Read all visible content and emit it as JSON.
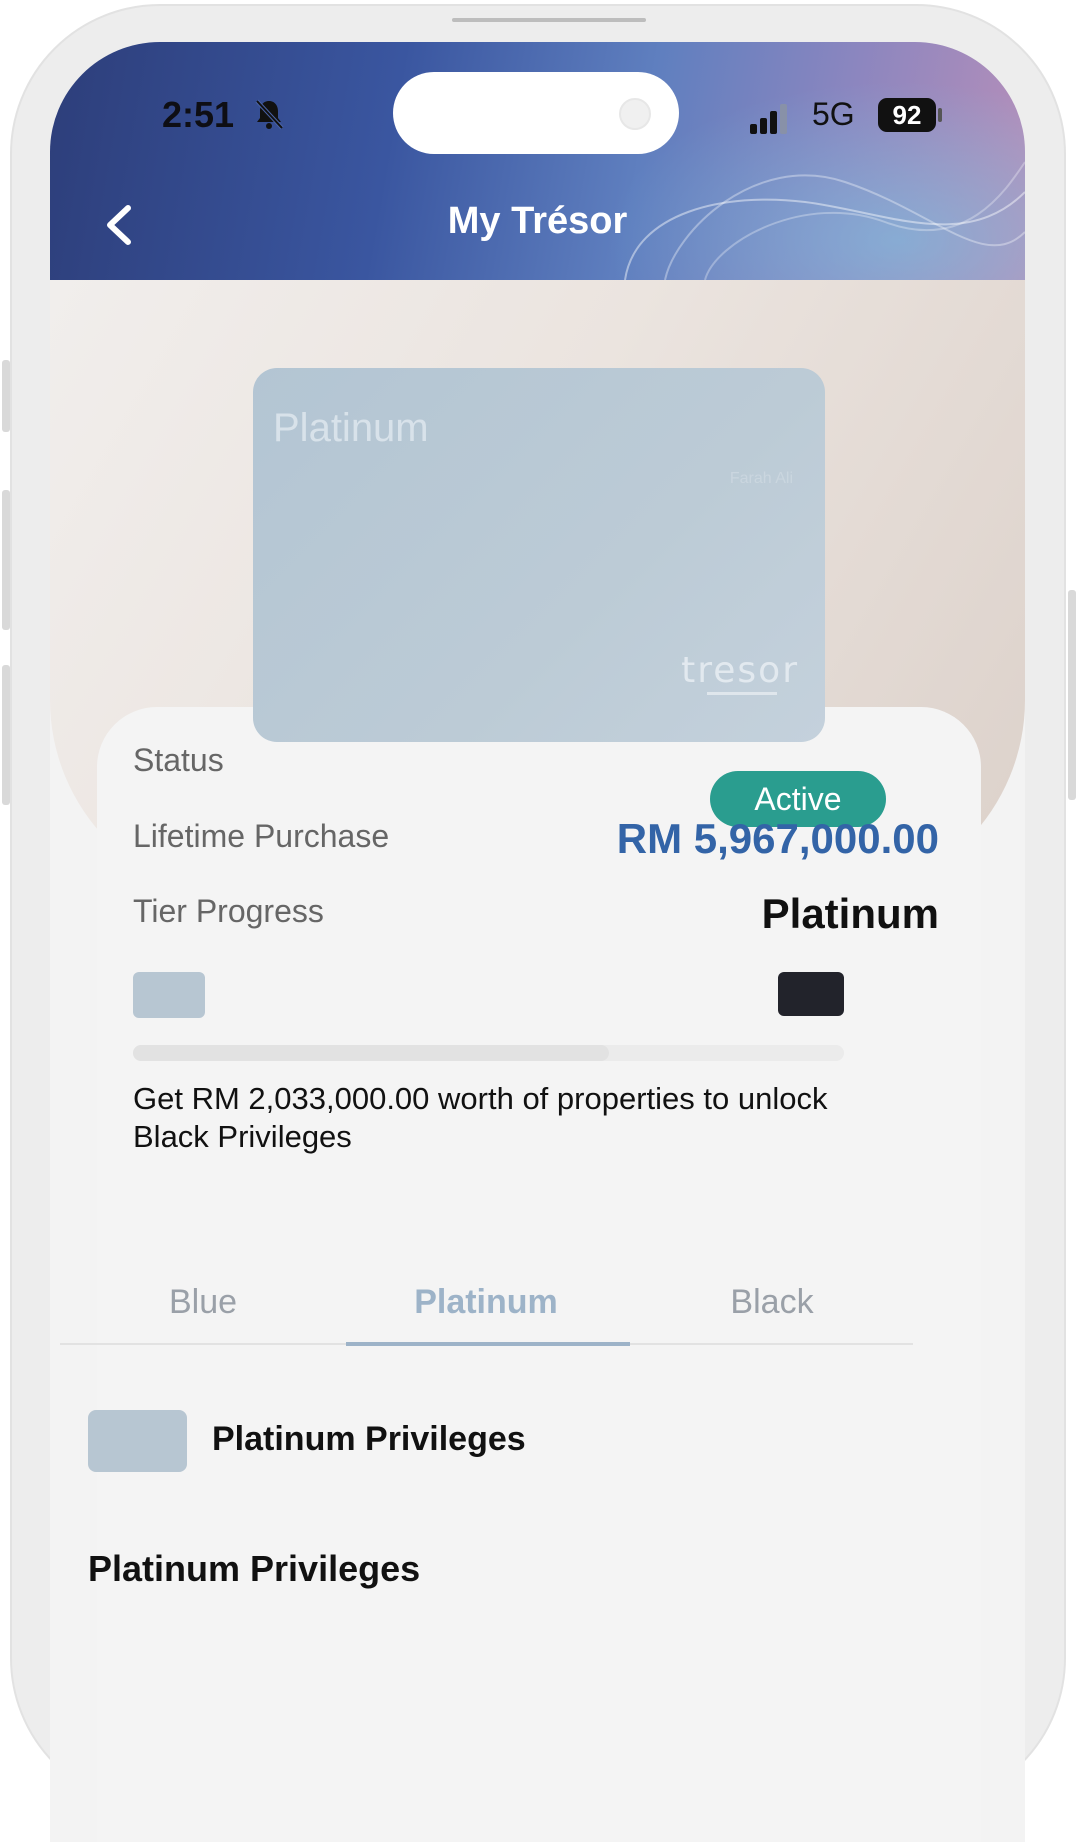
{
  "status_bar": {
    "time": "2:51",
    "network": "5G",
    "battery": "92"
  },
  "header": {
    "title": "My Trésor"
  },
  "card": {
    "tier": "Platinum",
    "holder": "Farah Ali",
    "logo": "tresor"
  },
  "details": {
    "status_label": "Status",
    "status_value": "Active",
    "lifetime_label": "Lifetime Purchase",
    "lifetime_value": "RM 5,967,000.00",
    "tier_label": "Tier Progress",
    "tier_value": "Platinum",
    "progress_fraction": 0.67,
    "hint": "Get RM 2,033,000.00 worth of properties to unlock Black Privileges"
  },
  "tabs": [
    {
      "label": "Blue"
    },
    {
      "label": "Platinum",
      "selected": true
    },
    {
      "label": "Black"
    }
  ],
  "privileges": {
    "title": "Platinum Privileges",
    "subtitle": "Platinum Privileges"
  },
  "colors": {
    "accent": "#3364a7",
    "active_badge": "#2a9d8f",
    "platinum": "#b7c6d2",
    "black": "#22232b"
  }
}
